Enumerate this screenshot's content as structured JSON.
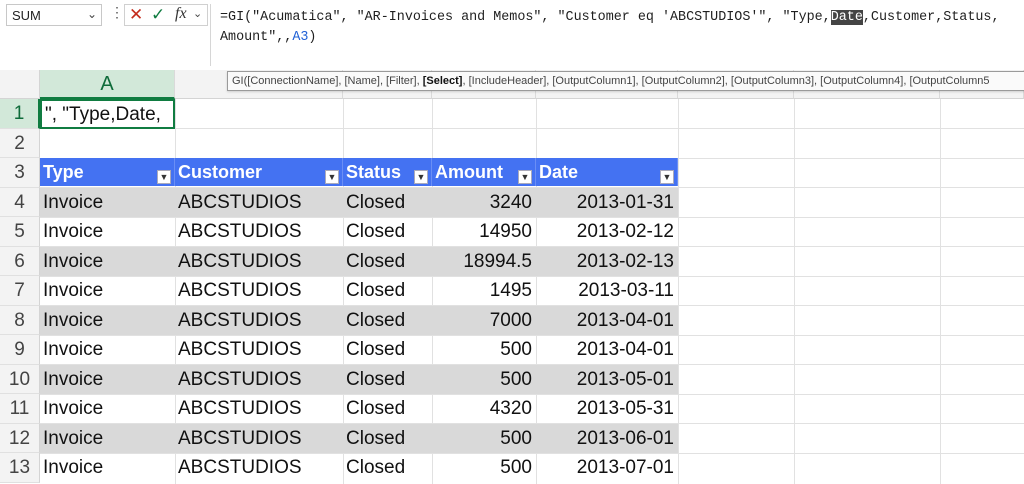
{
  "formula_bar": {
    "name_box": "SUM",
    "formula_part1": "=GI(\"Acumatica\", \"AR-Invoices and Memos\", \"Customer eq 'ABCSTUDIOS'\", \"Type,",
    "formula_highlight": "Date",
    "formula_part2": ",Customer,Status,\nAmount\",,",
    "formula_ref": "A3",
    "formula_end": ")"
  },
  "tooltip": {
    "prefix": "GI([ConnectionName], [Name], [Filter], ",
    "bold": "[Select]",
    "suffix": ", [IncludeHeader], [OutputColumn1], [OutputColumn2], [OutputColumn3], [OutputColumn4], [OutputColumn5"
  },
  "columns": {
    "A": "A"
  },
  "rows": [
    "1",
    "2",
    "3",
    "4",
    "5",
    "6",
    "7",
    "8",
    "9",
    "10",
    "11",
    "12",
    "13"
  ],
  "cell_A1": "\", \"Type,Date,",
  "table": {
    "headers": [
      "Type",
      "Customer",
      "Status",
      "Amount",
      "Date"
    ],
    "rows": [
      [
        "Invoice",
        "ABCSTUDIOS",
        "Closed",
        "3240",
        "2013-01-31"
      ],
      [
        "Invoice",
        "ABCSTUDIOS",
        "Closed",
        "14950",
        "2013-02-12"
      ],
      [
        "Invoice",
        "ABCSTUDIOS",
        "Closed",
        "18994.5",
        "2013-02-13"
      ],
      [
        "Invoice",
        "ABCSTUDIOS",
        "Closed",
        "1495",
        "2013-03-11"
      ],
      [
        "Invoice",
        "ABCSTUDIOS",
        "Closed",
        "7000",
        "2013-04-01"
      ],
      [
        "Invoice",
        "ABCSTUDIOS",
        "Closed",
        "500",
        "2013-04-01"
      ],
      [
        "Invoice",
        "ABCSTUDIOS",
        "Closed",
        "500",
        "2013-05-01"
      ],
      [
        "Invoice",
        "ABCSTUDIOS",
        "Closed",
        "4320",
        "2013-05-31"
      ],
      [
        "Invoice",
        "ABCSTUDIOS",
        "Closed",
        "500",
        "2013-06-01"
      ],
      [
        "Invoice",
        "ABCSTUDIOS",
        "Closed",
        "500",
        "2013-07-01"
      ]
    ]
  },
  "colors": {
    "header_blue": "#4472f2",
    "band_gray": "#d9d9d9",
    "select_green": "#107c41"
  }
}
